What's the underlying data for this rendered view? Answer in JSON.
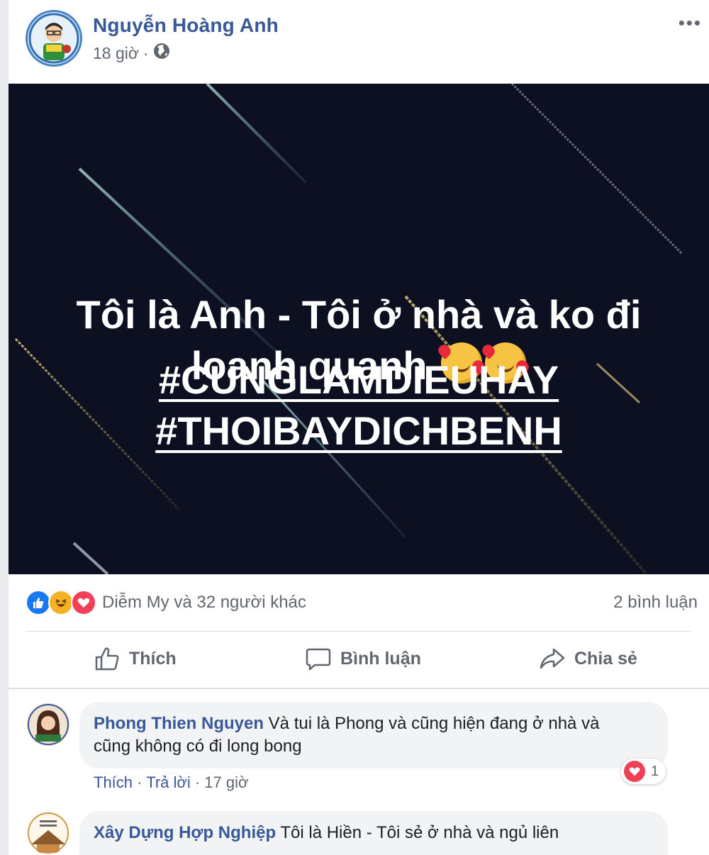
{
  "post": {
    "author": "Nguyễn Hoàng Anh",
    "time": "18 giờ",
    "separator": "·",
    "more_label": "•••",
    "text_line1": "Tôi là Anh - Tôi ở nhà và ko đi",
    "text_line2": "loanh quanh",
    "hashtag1": "#CUNGLAMDIEUHAY",
    "hashtag2": "#THOIBAYDICHBENH",
    "icons": {
      "privacy": "globe-icon",
      "emoji": "smiling-face-with-hearts-icon"
    }
  },
  "reactions": {
    "summary": "Diễm My và 32 người khác",
    "types": [
      "like-icon",
      "haha-icon",
      "love-icon"
    ],
    "comment_count": "2 bình luận"
  },
  "actions": {
    "like": "Thích",
    "comment": "Bình luận",
    "share": "Chia sẻ"
  },
  "comments": [
    {
      "name": "Phong Thien Nguyen",
      "text_line1": "Và tui là Phong và cũng hiện đang ở nhà và",
      "text_line2": "cũng không có đi long bong",
      "like": "Thích",
      "reply": "Trả lời",
      "time": "17 giờ",
      "separator": "·",
      "reaction_count": "1"
    },
    {
      "name": "Xây Dựng Hợp Nghiệp",
      "text_line1": "Tôi là Hiền - Tôi sẻ ở nhà và ngủ liên"
    }
  ],
  "colors": {
    "link": "#385898",
    "like": "#1877f2",
    "love": "#f33e58",
    "haha": "#f7b125",
    "image_bg": "#0d1020"
  }
}
